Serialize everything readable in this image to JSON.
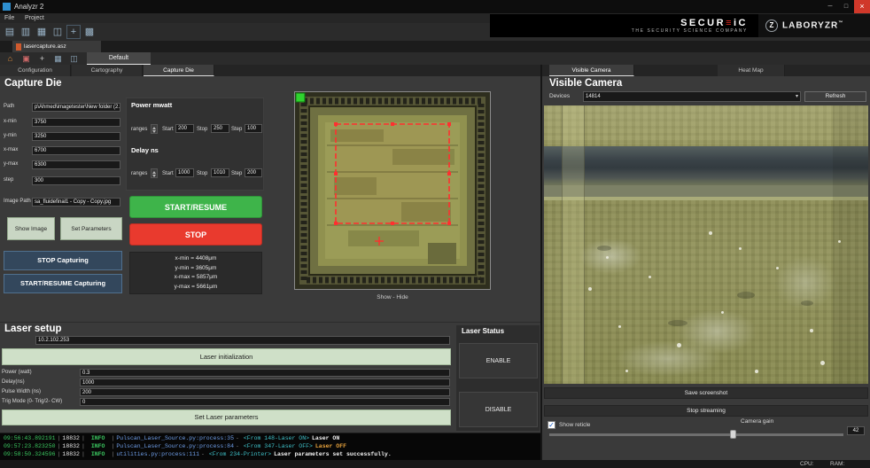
{
  "window": {
    "title": "Analyzr 2",
    "controls": {
      "minimize": "─",
      "maximize": "□",
      "close": "×"
    }
  },
  "menu": {
    "file": "File",
    "project": "Project"
  },
  "toolbar_main": {
    "icons": [
      {
        "name": "new-file-icon",
        "glyph": "▤"
      },
      {
        "name": "open-project-icon",
        "glyph": "▥"
      },
      {
        "name": "save-project-icon",
        "glyph": "▦"
      },
      {
        "name": "window-split-icon",
        "glyph": "◫"
      },
      {
        "name": "move-tool-icon",
        "glyph": "+"
      },
      {
        "name": "screens-grid-icon",
        "glyph": "▩"
      }
    ]
  },
  "brand": {
    "secureic": {
      "left": "SECUR",
      "accent": "≡",
      "right": "iC",
      "tagline": "THE SECURITY SCIENCE COMPANY"
    },
    "laboryzr": {
      "logo_letter": "Z",
      "name": "LABORYZR",
      "tm": "™"
    }
  },
  "document_tab": {
    "label": "lasercapture.asz"
  },
  "toolbar_secondary": {
    "icons": [
      {
        "name": "home-icon",
        "glyph": "⌂"
      },
      {
        "name": "image-tool-icon",
        "glyph": "▣"
      },
      {
        "name": "add-icon",
        "glyph": "+"
      },
      {
        "name": "grid-view-icon",
        "glyph": "▦"
      },
      {
        "name": "panes-view-icon",
        "glyph": "◫"
      }
    ],
    "profile_tab": "Default"
  },
  "tabs_left": [
    {
      "label": "Configuration"
    },
    {
      "label": "Cartography"
    },
    {
      "label": "Capture Die"
    }
  ],
  "tabs_right": [
    {
      "label": "Visible Camera"
    },
    {
      "label": "Heat Map"
    }
  ],
  "capture_die": {
    "title": "Capture Die",
    "fields": [
      {
        "label": "Path",
        "value": "p\\Ahmed\\imagetester\\New folder (2..."
      },
      {
        "label": "x-min",
        "value": "3750"
      },
      {
        "label": "y-min",
        "value": "3250"
      },
      {
        "label": "x-max",
        "value": "6700"
      },
      {
        "label": "y-max",
        "value": "6300"
      },
      {
        "label": "step",
        "value": "300"
      },
      {
        "label": "Image Path",
        "value": "sa_fluidefinal1 - Copy - Copy.jpg"
      }
    ],
    "show_image": "Show Image",
    "set_parameters": "Set Parameters",
    "stop_capturing": "STOP Capturing",
    "start_resume_capturing": "START/RESUME Capturing"
  },
  "scan": {
    "power_header": "Power mwatt",
    "delay_header": "Delay ns",
    "ranges_label": "ranges",
    "start_label": "Start",
    "stop_label": "Stop",
    "step_label": "Step",
    "power": {
      "start": "200",
      "stop": "250",
      "step": "100"
    },
    "delay": {
      "start": "1000",
      "stop": "1010",
      "step": "200"
    },
    "start_resume": "START/RESUME",
    "stop": "STOP",
    "info": [
      "x-min = 4408μm",
      "y-min = 3605μm",
      "x-max = 5857μm",
      "y-max = 5661μm"
    ]
  },
  "die_view": {
    "toggle": "Show - Hide"
  },
  "visible_camera": {
    "title": "Visible Camera",
    "devices_label": "Devices",
    "device_selected": "14814",
    "dropdown_arrow": "▾",
    "refresh": "Refresh",
    "save_screenshot": "Save screenshot",
    "stop_streaming": "Stop streaming",
    "show_reticle": "Show reticle",
    "check_glyph": "✓",
    "camera_gain": "Camera gain",
    "gain_value": "42"
  },
  "laser_setup": {
    "title": "Laser setup",
    "ip": "10.2.102.253",
    "init_button": "Laser initialization",
    "fields": [
      {
        "label": "Power (watt)",
        "value": "0.3"
      },
      {
        "label": "Delay(ns)",
        "value": "1000"
      },
      {
        "label": "Pulse Width (ns)",
        "value": "200"
      },
      {
        "label": "Trig Mode (0- Trig/2- CW)",
        "value": "0"
      }
    ],
    "set_button": "Set Laser parameters"
  },
  "laser_status": {
    "title": "Laser Status",
    "enable": "ENABLE",
    "disable": "DISABLE"
  },
  "console": {
    "sep": "|",
    "dash": "-",
    "lines": [
      {
        "time": "09:56:43.892191",
        "pid": "18832",
        "level": "INFO",
        "source": "Pulscan_Laser_Source.py:process:35",
        "origin": "<From 148-Laser ON>",
        "message": "Laser ON"
      },
      {
        "time": "09:57:23.823250",
        "pid": "18832",
        "level": "INFO",
        "source": "Pulscan_Laser_Source.py:process:84",
        "origin": "<From 347-Laser OFF>",
        "message": "Laser OFF"
      },
      {
        "time": "09:58:50.324596",
        "pid": "18832",
        "level": "INFO",
        "source": "utilities.py:process:111",
        "origin": "<From 234-Printer>",
        "message": "Laser parameters set successfully."
      }
    ]
  },
  "status_bar": {
    "cpu": "CPU:",
    "ram": "RAM:"
  },
  "colors": {
    "start_green": "#3eb44a",
    "stop_red": "#e93a2e",
    "init_bar_green": "#cfe0c8",
    "navy_button": "#33475c",
    "logo_accent_red": "#e0281e",
    "scan_region_red": "#ff2f2f",
    "log_green": "#3bc860",
    "log_blue": "#6f9ee8",
    "log_cyan": "#3fc1c9",
    "log_warn": "#e8a33d"
  }
}
